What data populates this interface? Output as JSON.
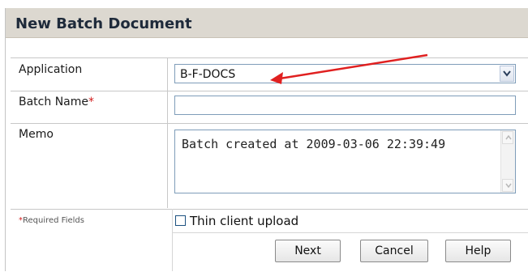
{
  "panel": {
    "title": "New Batch Document"
  },
  "form": {
    "application": {
      "label": "Application",
      "value": "B-F-DOCS"
    },
    "batch_name": {
      "label": "Batch Name",
      "required_mark": "*",
      "value": ""
    },
    "memo": {
      "label": "Memo",
      "value": "Batch created at 2009-03-06 22:39:49"
    }
  },
  "footer": {
    "required_mark": "*",
    "required_note": "Required Fields",
    "thin_client_label": "Thin client upload",
    "thin_client_checked": false
  },
  "buttons": {
    "next": "Next",
    "cancel": "Cancel",
    "help": "Help"
  },
  "colors": {
    "title_bar": "#dcd8d0",
    "required": "#d21c1c",
    "annotation_arrow": "#e02020",
    "input_border": "#7f9db9"
  },
  "icons": [
    "chevron-down-icon",
    "scroll-up-icon",
    "scroll-down-icon",
    "red-annotation-arrow"
  ]
}
